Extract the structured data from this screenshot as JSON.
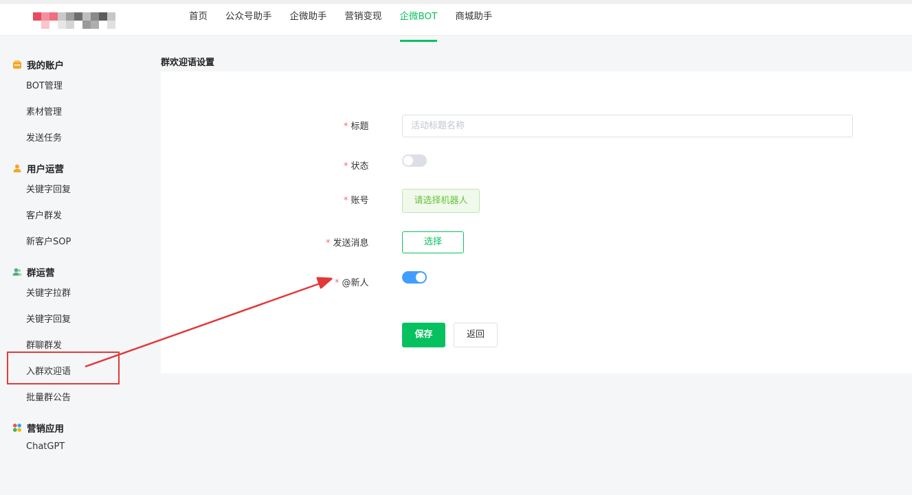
{
  "nav": {
    "items": [
      "首页",
      "公众号助手",
      "企微助手",
      "营销变现",
      "企微BOT",
      "商城助手"
    ],
    "active_index": 4
  },
  "sidebar": {
    "groups": [
      {
        "title": "我的账户",
        "icon": "wallet-icon",
        "items": [
          "BOT管理",
          "素材管理",
          "发送任务"
        ]
      },
      {
        "title": "用户运营",
        "icon": "user-icon",
        "items": [
          "关键字回复",
          "客户群发",
          "新客户SOP"
        ]
      },
      {
        "title": "群运营",
        "icon": "group-icon",
        "items": [
          "关键字拉群",
          "关键字回复",
          "群聊群发",
          "入群欢迎语",
          "批量群公告"
        ]
      },
      {
        "title": "营销应用",
        "icon": "apps-icon",
        "items": [
          "ChatGPT"
        ]
      }
    ],
    "highlighted_item": "入群欢迎语"
  },
  "main": {
    "section_title": "群欢迎语设置",
    "form": {
      "required_mark": "*",
      "title_label": "标题",
      "title_placeholder": "活动标题名称",
      "title_value": "",
      "status_label": "状态",
      "status_on": false,
      "account_label": "账号",
      "account_button": "请选择机器人",
      "message_label": "发送消息",
      "message_button": "选择",
      "mention_label": "@新人",
      "mention_on": true,
      "save_button": "保存",
      "back_button": "返回"
    }
  },
  "colors": {
    "accent": "#07c160",
    "toggle_on": "#409eff",
    "annotation": "#e23838",
    "required": "#f56c6c"
  }
}
